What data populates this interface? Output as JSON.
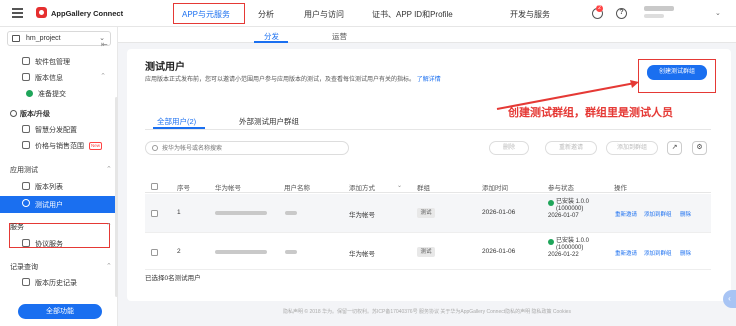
{
  "topbar": {
    "brand": "AppGallery Connect",
    "nav": [
      "APP与元服务",
      "分析",
      "用户与访问",
      "证书、APP ID和Profile",
      "开发与服务"
    ],
    "badge_count": "2",
    "help_label": "?",
    "user_caret": "⌄"
  },
  "sidebar": {
    "project": "hm_project",
    "project_caret": "⌄",
    "collapse_icon": "⇤",
    "items": [
      {
        "label": "软件包管理"
      },
      {
        "label": "版本信息"
      },
      {
        "label": "准备提交"
      },
      {
        "label": "版本/升级"
      },
      {
        "label": "智慧分发配置"
      },
      {
        "label": "价格与销售范围",
        "badge": "New"
      },
      {
        "label": "版本列表"
      },
      {
        "label": "测试用户"
      },
      {
        "label": "协议服务"
      },
      {
        "label": "版本历史记录"
      }
    ],
    "sections": [
      "应用测试",
      "服务",
      "记录查询"
    ],
    "all_functions": "全部功能"
  },
  "subtabs": [
    "分发",
    "运营"
  ],
  "page": {
    "title": "测试用户",
    "description": "应用版本正式发布前，您可以邀请小范围用户参与应用版本的测试，及查看每位测试用户有关的指标。",
    "learn_more": "了解详情",
    "create_button": "创建测试群组",
    "annotation": "创建测试群组，群组里是测试人员"
  },
  "tabs": [
    "全部用户(2)",
    "外部测试用户群组"
  ],
  "toolbar": {
    "search_placeholder": "按华为帐号或名称搜索",
    "delete": "删除",
    "resend_invite": "重新邀请",
    "add_to_group": "添加到群组",
    "export_icon": "↗",
    "settings_icon": "⚙"
  },
  "table": {
    "headers": [
      "序号",
      "华为帐号",
      "用户名称",
      "添加方式",
      "群组",
      "添加时间",
      "参与状态",
      "操作"
    ],
    "rows": [
      {
        "index": "1",
        "method": "华为帐号",
        "group": "测试",
        "time": "2026-01-06",
        "status": "已安装 1.0.0",
        "version": "(1000000)",
        "status_date": "2026-01-07"
      },
      {
        "index": "2",
        "method": "华为帐号",
        "group": "测试",
        "time": "2026-01-06",
        "status": "已安装 1.0.0",
        "version": "(1000000)",
        "status_date": "2026-01-22"
      }
    ],
    "ops": [
      "重新邀请",
      "添加到群组",
      "删除"
    ],
    "selected": "已选择0名测试用户"
  },
  "footer": "隐私声明 © 2018 华为。保留一切权利。苏ICP备17040376号   服务协议   关于华为AppGallery Connect隐私的声明   隐私政策   Cookies",
  "colors": {
    "accent": "#1a6ff0",
    "annotation_red": "#e53935",
    "ok_green": "#1fa55a"
  }
}
